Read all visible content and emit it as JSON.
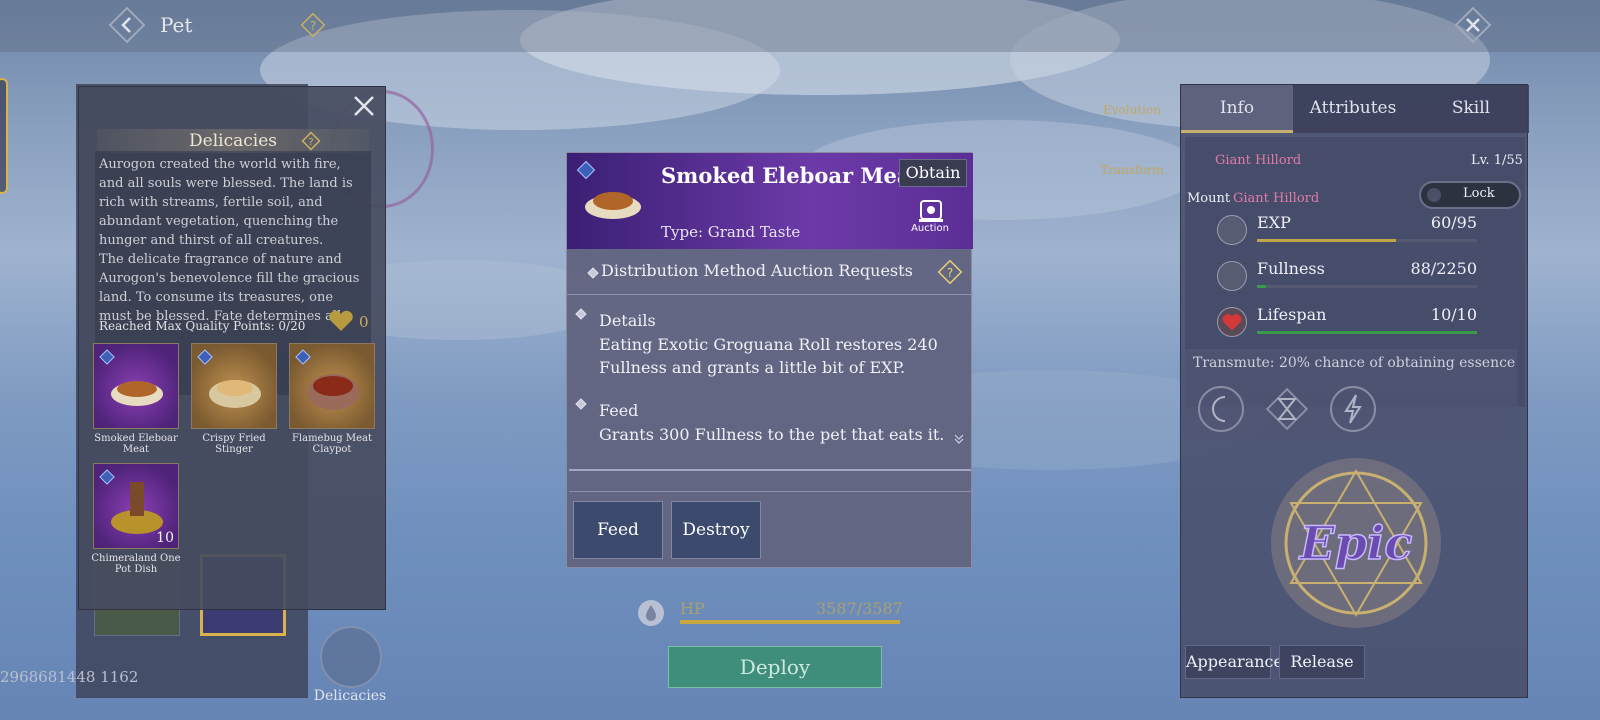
{
  "topbar": {
    "title": "Pet",
    "back_icon": "back-arrow-icon",
    "help_icon": "question-icon",
    "close_icon": "close-icon"
  },
  "background": {
    "pet_id": "2968681448 1162",
    "delicacies_tab_label": "Delicacies",
    "hp": {
      "label": "HP",
      "value": "3587/3587",
      "fill": 1.0
    },
    "deploy_label": "Deploy",
    "evolution_label": "Evolution",
    "transform_label": "Transform"
  },
  "delicacies": {
    "title": "Delicacies",
    "description": [
      "Aurogon created the world with fire, and all souls were blessed. The land is rich with streams, fertile soil, and abundant vegetation, quenching the hunger and thirst of all creatures.",
      "The delicate fragrance of nature and Aurogon's benevolence fill the gracious land. To consume its treasures, one must be  blessed. Fate determines all."
    ],
    "quality_points": "Reached Max Quality Points: 0/20",
    "heart_count": "0",
    "items": [
      {
        "name": "Smoked Eleboar Meat",
        "rarity": "purple",
        "count": ""
      },
      {
        "name": "Crispy Fried Stinger",
        "rarity": "gold",
        "count": ""
      },
      {
        "name": "Flamebug Meat Claypot",
        "rarity": "gold",
        "count": ""
      },
      {
        "name": "Chimeraland One Pot Dish",
        "rarity": "purple",
        "count": "10"
      }
    ]
  },
  "detail": {
    "name": "Smoked Eleboar Meat",
    "obtain_label": "Obtain",
    "auction_label": "Auction",
    "type": "Type: Grand Taste",
    "distribution_label": "Distribution Method",
    "distribution_value": "Auction Requests",
    "details_heading": "Details",
    "details_text": "Eating Exotic Groguana Roll restores 240 Fullness and grants a little bit of EXP.",
    "feed_heading": "Feed",
    "feed_text": "Grants 300 Fullness to the pet that eats it.",
    "feed_button": "Feed",
    "destroy_button": "Destroy"
  },
  "right_panel": {
    "tabs": [
      "Info",
      "Attributes",
      "Skill"
    ],
    "active_tab": 0,
    "pet_name": "Giant Hillord",
    "level": "Lv. 1/55",
    "mount_label": "Mount",
    "mount_name": "Giant Hillord",
    "lock_label": "Lock",
    "stats": [
      {
        "label": "EXP",
        "value": "60/95",
        "fill": 0.63,
        "color": "#bfa548"
      },
      {
        "label": "Fullness",
        "value": "88/2250",
        "fill": 0.04,
        "color": "#3a9a4a"
      },
      {
        "label": "Lifespan",
        "value": "10/10",
        "fill": 1.0,
        "color": "#3a9a4a"
      }
    ],
    "transmute": "Transmute: 20% chance of obtaining essence",
    "rarity_badge": "Epic",
    "appearance_button": "Appearance",
    "release_button": "Release"
  }
}
